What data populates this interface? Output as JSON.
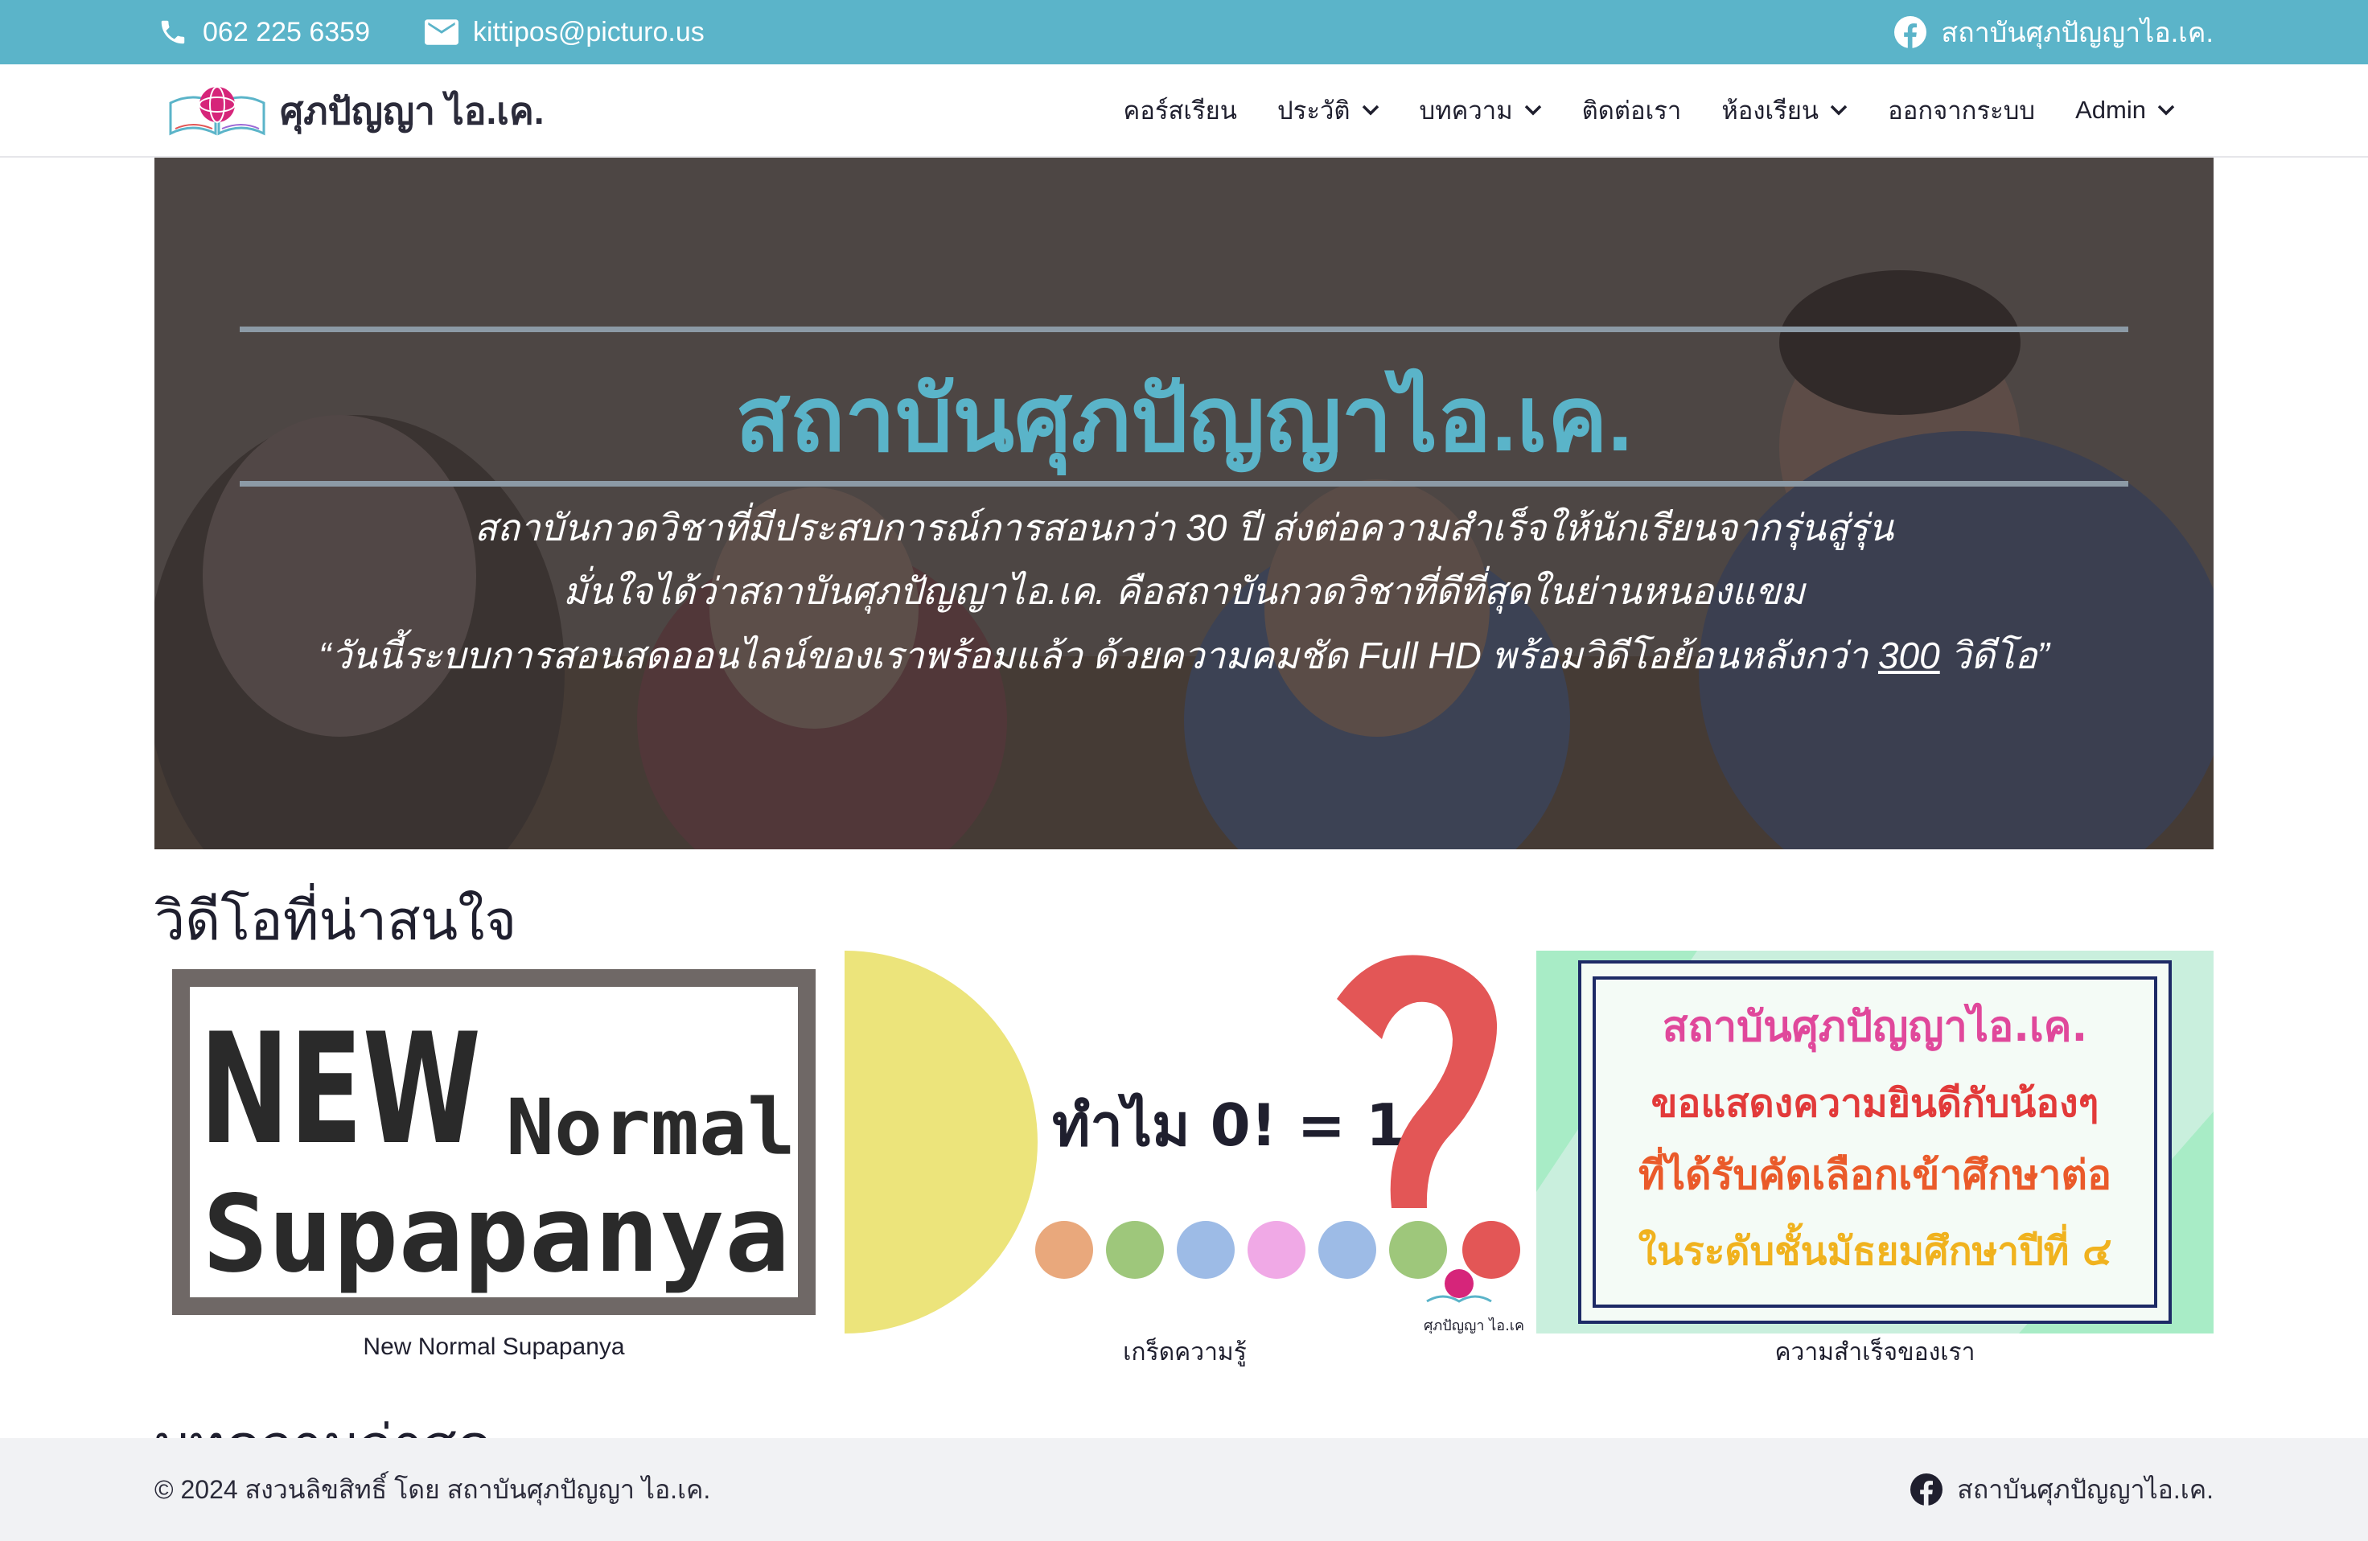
{
  "topbar": {
    "phone": "062 225 6359",
    "email": "kittipos@picturo.us",
    "facebook": "สถาบันศุภปัญญาไอ.เค."
  },
  "nav": {
    "logo_text": "ศุภปัญญา ไอ.เค.",
    "items": [
      {
        "label": "คอร์สเรียน"
      },
      {
        "label": "ประวัติ"
      },
      {
        "label": "บทความ"
      },
      {
        "label": "ติดต่อเรา"
      },
      {
        "label": "ห้องเรียน"
      },
      {
        "label": "ออกจากระบบ"
      },
      {
        "label": "Admin"
      }
    ]
  },
  "hero": {
    "title": "สถาบันศุภปัญญาไอ.เค.",
    "line1": "สถาบันกวดวิชาที่มีประสบการณ์การสอนกว่า 30 ปี ส่งต่อความสำเร็จให้นักเรียนจากรุ่นสู่รุ่น",
    "line2": "มั่นใจได้ว่าสถาบันศุภปัญญาไอ.เค. คือสถาบันกวดวิชาที่ดีที่สุดในย่านหนองแขม",
    "line3_start": "“วันนี้ระบบการสอนสดออนไลน์ของเราพร้อมแล้ว ด้วยความคมชัด Full HD พร้อมวิดีโอย้อนหลังกว่า ",
    "line3_number": "300",
    "line3_end": " วิดีโอ”"
  },
  "videos": {
    "section_title": "วิดีโอที่น่าสนใจ",
    "cards": [
      {
        "caption": "New Normal Supapanya",
        "thumb_line1": "NEW",
        "thumb_line1b": "Normal",
        "thumb_line2": "Supapanya"
      },
      {
        "caption": "เกร็ดความรู้",
        "thumb_text": "ทำไม 0! = 1",
        "thumb_logo": "ศุภปัญญา ไอ.เค."
      },
      {
        "caption": "ความสำเร็จของเรา",
        "thumb_l1": "สถาบันศุภปัญญาไอ.เค.",
        "thumb_l2": "ขอแสดงความยินดีกับน้องๆ",
        "thumb_l3": "ที่ได้รับคัดเลือกเข้าศึกษาต่อ",
        "thumb_l4": "ในระดับชั้นมัธยมศึกษาปีที่ ๔"
      }
    ]
  },
  "articles": {
    "section_title": "บทความล่าสุด"
  },
  "footer": {
    "copyright": "© 2024 สงวนลิขสิทธิ์ โดย สถาบันศุภปัญญา ไอ.เค.",
    "facebook": "สถาบันศุภปัญญาไอ.เค."
  },
  "colors": {
    "accent": "#5bb4c9",
    "brand_pink": "#d6257a",
    "footer_bg": "#f1f2f4",
    "dot_colors": [
      "#e9a87c",
      "#9ec77b",
      "#9dbbe6",
      "#f0a9e6",
      "#9dbbe6",
      "#9ec77b",
      "#e35656"
    ]
  }
}
